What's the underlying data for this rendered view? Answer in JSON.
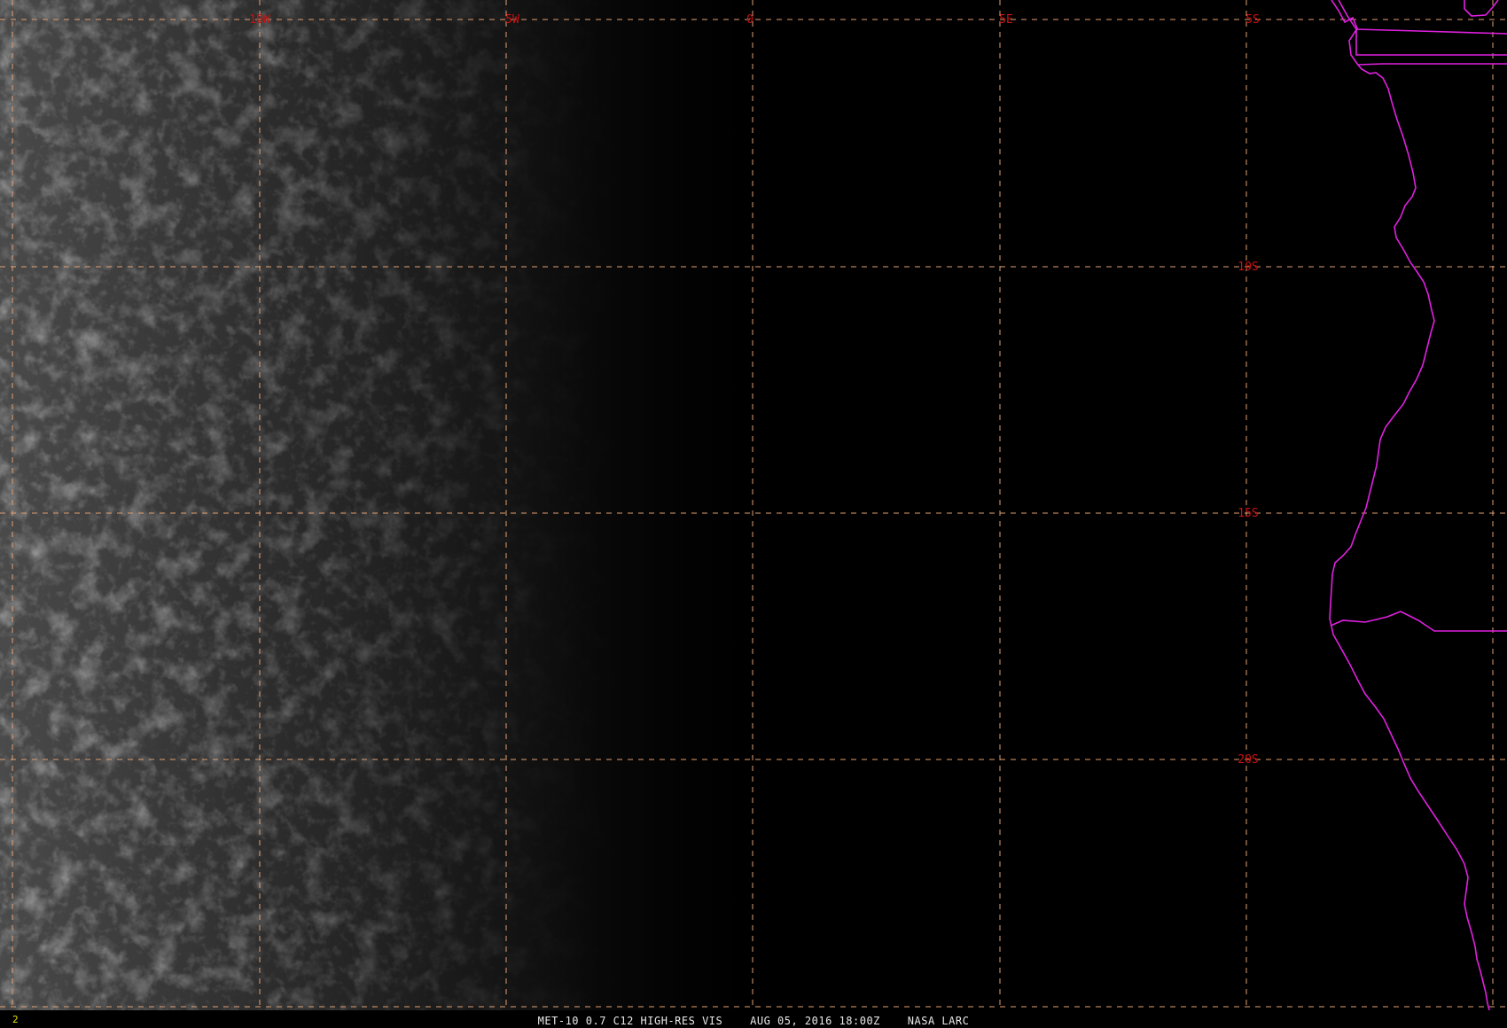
{
  "map": {
    "grid_labels": {
      "lon": [
        "10W",
        "5W",
        "0",
        "5E"
      ],
      "lat": [
        "5S",
        "10S",
        "15S",
        "20S"
      ]
    },
    "colors": {
      "grid": "#e0a070",
      "grid_label": "#cc1111",
      "coastline": "#e020e0",
      "frame_number": "#e6e600",
      "caption": "#e8e8e8"
    }
  },
  "footer": {
    "frame_number": "2",
    "caption": "MET-10 0.7 C12 HIGH-RES VIS    AUG 05, 2016 18:00Z    NASA LARC"
  }
}
